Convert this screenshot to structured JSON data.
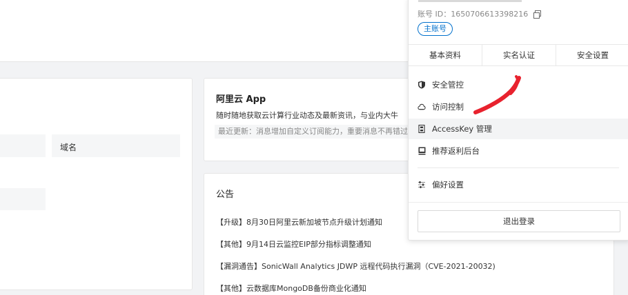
{
  "main": {
    "left_card": {
      "domain_label": "域名"
    },
    "app_card": {
      "title": "阿里云 App",
      "description": "随时随地获取云计算行业动态及最新资讯，与业内大牛",
      "update": "最近更新：消息增加自定义订阅能力，重要消息不再错过"
    },
    "notice_card": {
      "title": "公告",
      "items": [
        "【升级】8月30日阿里云新加坡节点升级计划通知",
        "【其他】9月14日云监控EIP部分指标调整通知",
        "【漏洞通告】SonicWall Analytics JDWP 远程代码执行漏洞（CVE-2021-20032)",
        "【其他】云数据库MongoDB备份商业化通知"
      ]
    }
  },
  "dropdown": {
    "account_id": "账号 ID：1650706613398216",
    "account_badge": "主账号",
    "tabs": [
      "基本资料",
      "实名认证",
      "安全设置"
    ],
    "menu": {
      "security": {
        "label": "安全管控",
        "icon": "shield-icon"
      },
      "access": {
        "label": "访问控制",
        "icon": "cloud-icon"
      },
      "accesskey": {
        "label": "AccessKey 管理",
        "icon": "key-icon"
      },
      "referral": {
        "label": "推荐返利后台",
        "icon": "book-icon"
      },
      "preferences": {
        "label": "偏好设置",
        "icon": "sliders-icon"
      }
    },
    "logout": "退出登录"
  },
  "colors": {
    "accent": "#0070cc",
    "annotation": "#e8222e",
    "page_bg": "#f2f3f5"
  }
}
